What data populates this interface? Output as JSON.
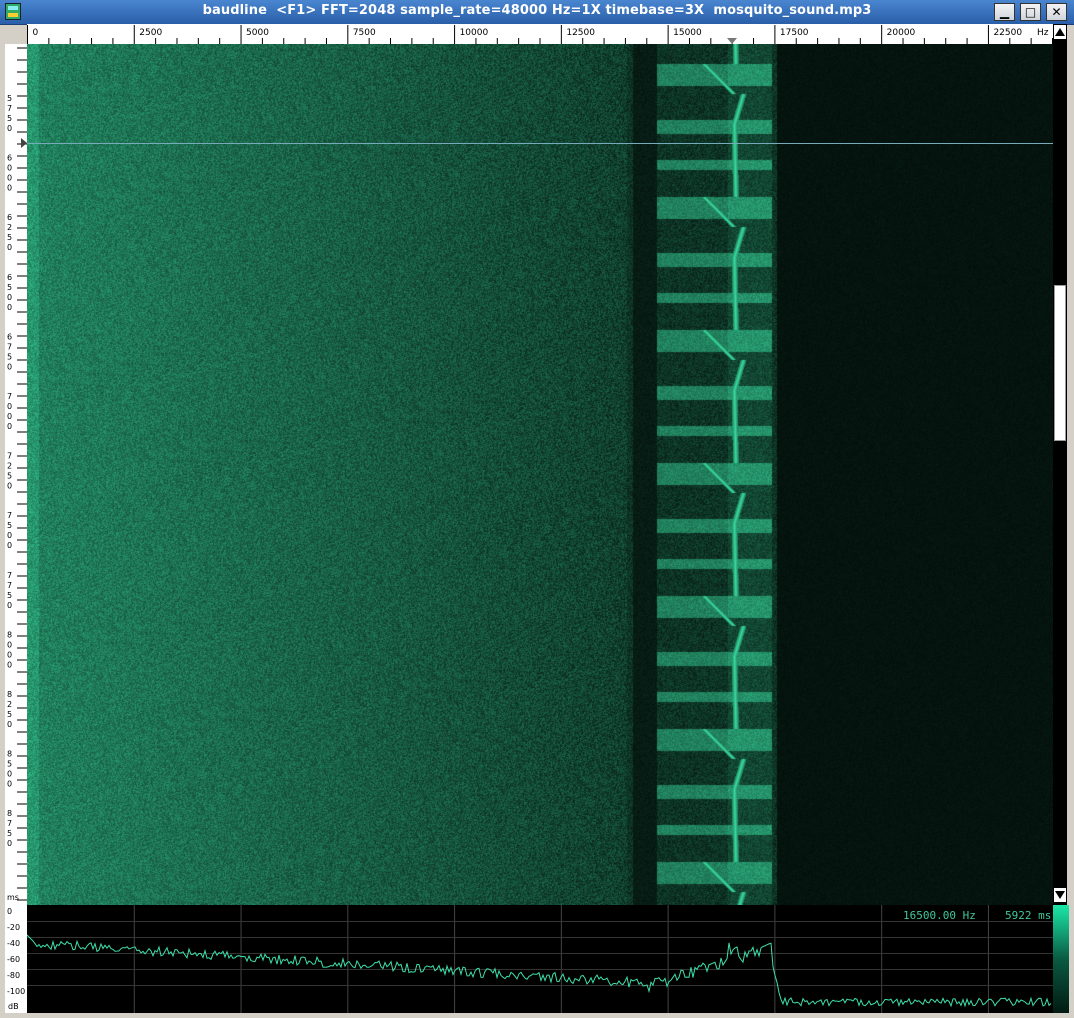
{
  "window": {
    "title": "baudline  <F1> FFT=2048 sample_rate=48000 Hz=1X timebase=3X  mosquito_sound.mp3",
    "buttons": {
      "minimize": "▁",
      "maximize": "□",
      "close": "✕"
    }
  },
  "frequency_axis": {
    "labels": [
      "0",
      "2500",
      "5000",
      "7500",
      "10000",
      "12500",
      "15000",
      "17500",
      "20000",
      "22500"
    ],
    "unit": "Hz",
    "max_hz": 24000
  },
  "time_axis": {
    "labels": [
      "575\n0",
      "600\n0",
      "625\n0",
      "650\n0",
      "675\n0",
      "700\n0",
      "725\n0",
      "750\n0",
      "775\n0",
      "800\n0",
      "825\n0",
      "850\n0",
      "875\n0"
    ],
    "unit": "ms"
  },
  "db_axis": {
    "labels": [
      "0",
      "-20",
      "-40",
      "-60",
      "-80",
      "-100"
    ],
    "unit": "dB"
  },
  "readout": {
    "frequency": "16500.00 Hz",
    "time": "5922 ms"
  },
  "colors": {
    "spectrum_line": "#3fe0a8",
    "background": "#000000",
    "accent": "#1be8a8"
  },
  "icons": {
    "app": "baudline-app-icon",
    "scroll_up": "triangle-up-icon",
    "scroll_down": "triangle-down-icon"
  }
}
